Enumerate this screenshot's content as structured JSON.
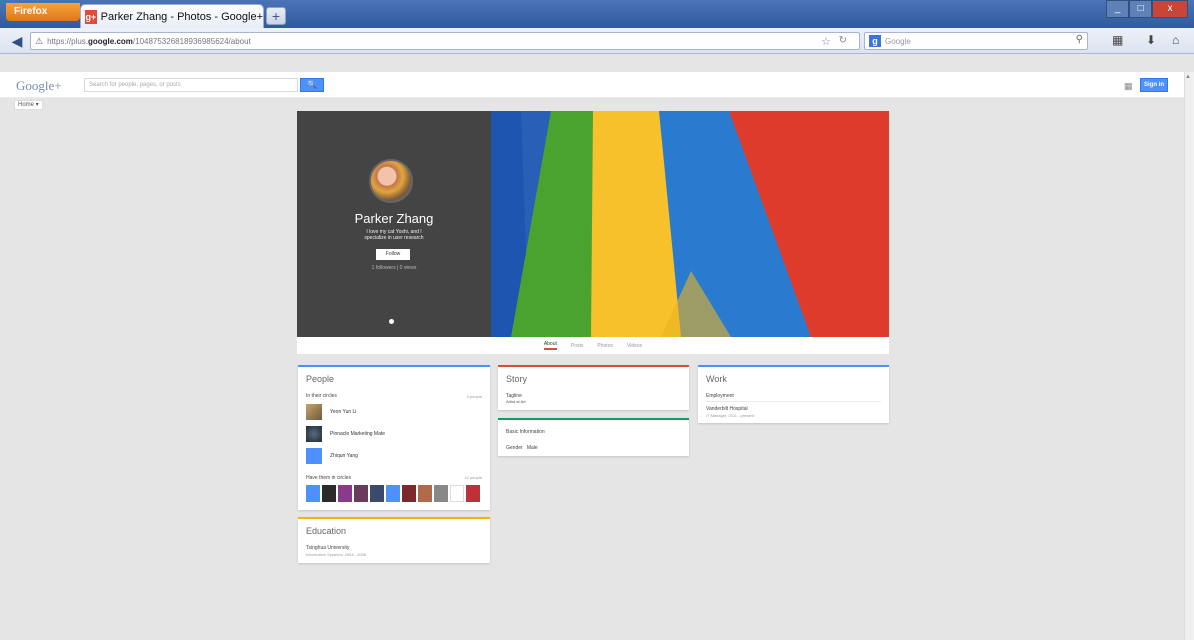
{
  "browser": {
    "menu_button": "Firefox",
    "tab_title": "Parker Zhang - Photos - Google+",
    "favicon_letter": "g+",
    "new_tab": "+",
    "url_prefix": "https://plus.",
    "url_domain": "google.com",
    "url_path": "/104875326818936985624/about",
    "search_engine": "Google",
    "window_controls": [
      "_",
      "□",
      "x"
    ]
  },
  "gplus": {
    "logo": "Google+",
    "search_placeholder": "Search for people, pages, or posts",
    "search_button": "🔍",
    "signin": "Sign in",
    "home": "Home ▾"
  },
  "profile": {
    "name": "Parker Zhang",
    "tagline": "I love my cat Yoshi, and I specialize in user research",
    "follow": "Follow",
    "followers": "1 followers | 0 views",
    "tabs": [
      "About",
      "Posts",
      "Photos",
      "Videos"
    ],
    "active_tab": "About"
  },
  "people": {
    "title": "People",
    "in_circles_label": "In their circles",
    "in_circles_count": "3 people",
    "items": [
      {
        "name": "Yeon Yun Li"
      },
      {
        "name": "Pinnacle Marketing Mate"
      },
      {
        "name": "Zhiqun Yang"
      }
    ],
    "have_in_circles_label": "Have them in circles",
    "have_in_circles_count": "12 people"
  },
  "education": {
    "title": "Education",
    "school": "Tsinghua University",
    "detail": "Information Systems, 2004 - 2008"
  },
  "story": {
    "title": "Story",
    "label": "Tagline",
    "value": "Artist at Art"
  },
  "basic_info": {
    "title": "Basic Information",
    "gender_label": "Gender",
    "gender_value": "Male"
  },
  "work": {
    "title": "Work",
    "label": "Employment",
    "employer": "Vanderbilt Hospital",
    "detail": "IT Manager, 2011 - present"
  },
  "colors": {
    "cover_dark": "#444444",
    "gplus_red": "#dd4b39",
    "blue": "#4d90fe",
    "art_green": "#4aa32e",
    "art_yellow": "#f6c12a",
    "art_blue": "#2a7ad0",
    "art_red": "#df3b2c"
  }
}
